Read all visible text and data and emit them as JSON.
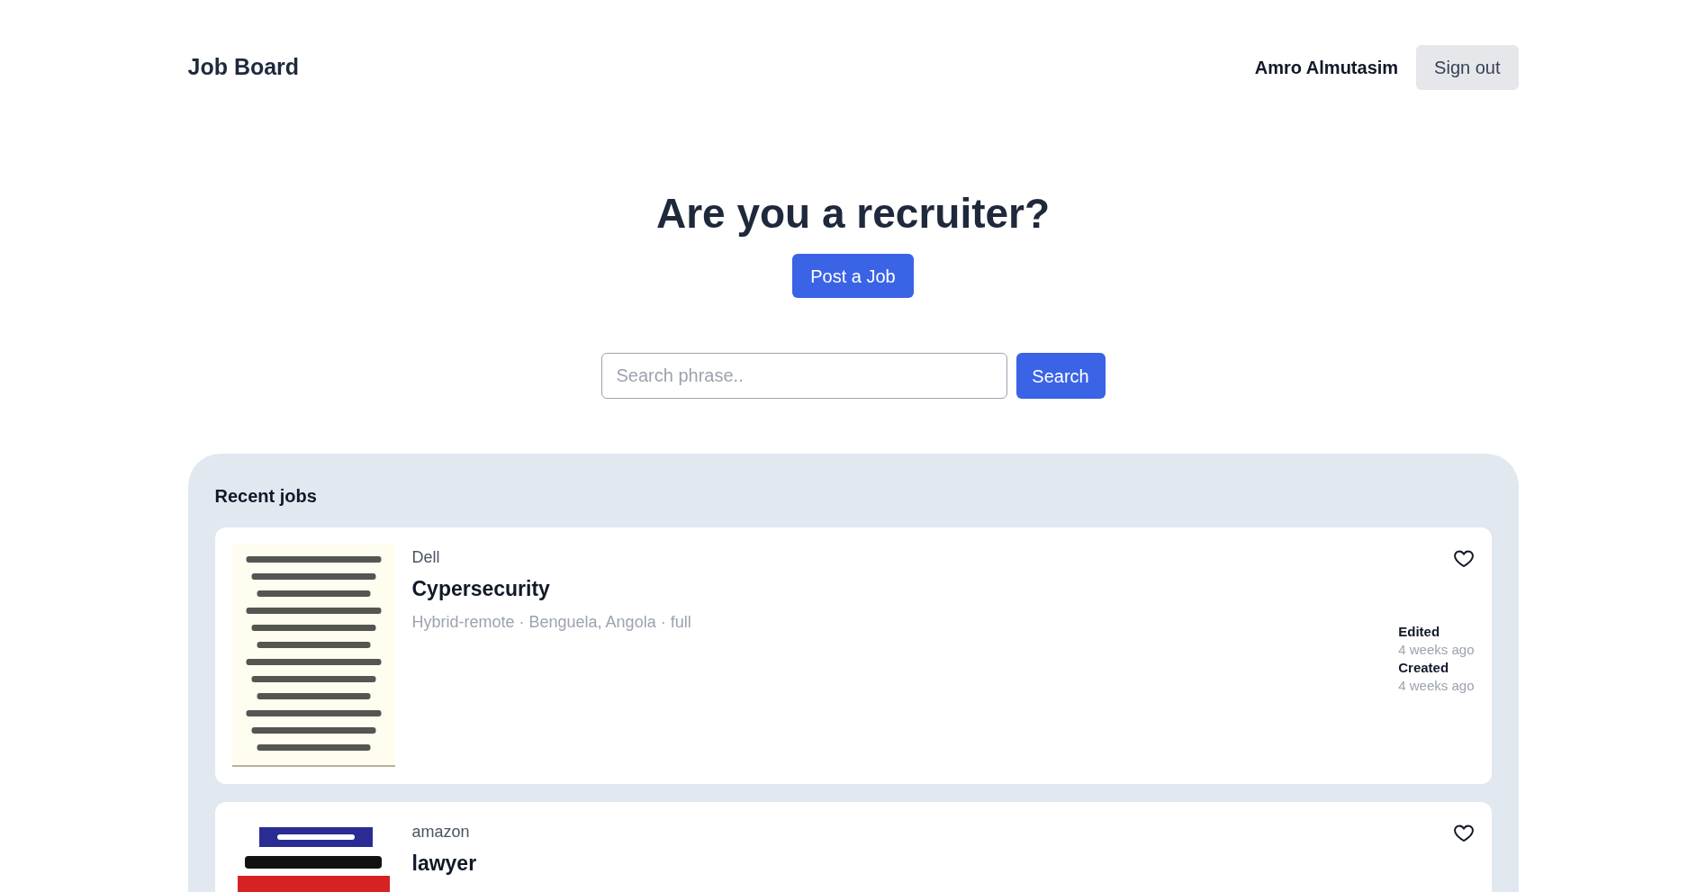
{
  "header": {
    "brand": "Job Board",
    "user_name": "Amro Almutasim",
    "sign_out": "Sign out"
  },
  "hero": {
    "heading": "Are you a recruiter?",
    "button": "Post a Job"
  },
  "search": {
    "placeholder": "Search phrase..",
    "button": "Search"
  },
  "recent": {
    "title": "Recent jobs",
    "jobs": [
      {
        "kind": "picture",
        "company": "Dell",
        "title": "Cypersecurity",
        "meta": "Hybrid-remote · Benguela, Angola · full",
        "favorite": false,
        "edited_label": "Edited",
        "edited": "4 weeks ago",
        "created_label": "Created",
        "created": "4 weeks ago"
      },
      {
        "kind": "picture",
        "company": "amazon",
        "title": "lawyer",
        "favorite": false
      }
    ]
  }
}
